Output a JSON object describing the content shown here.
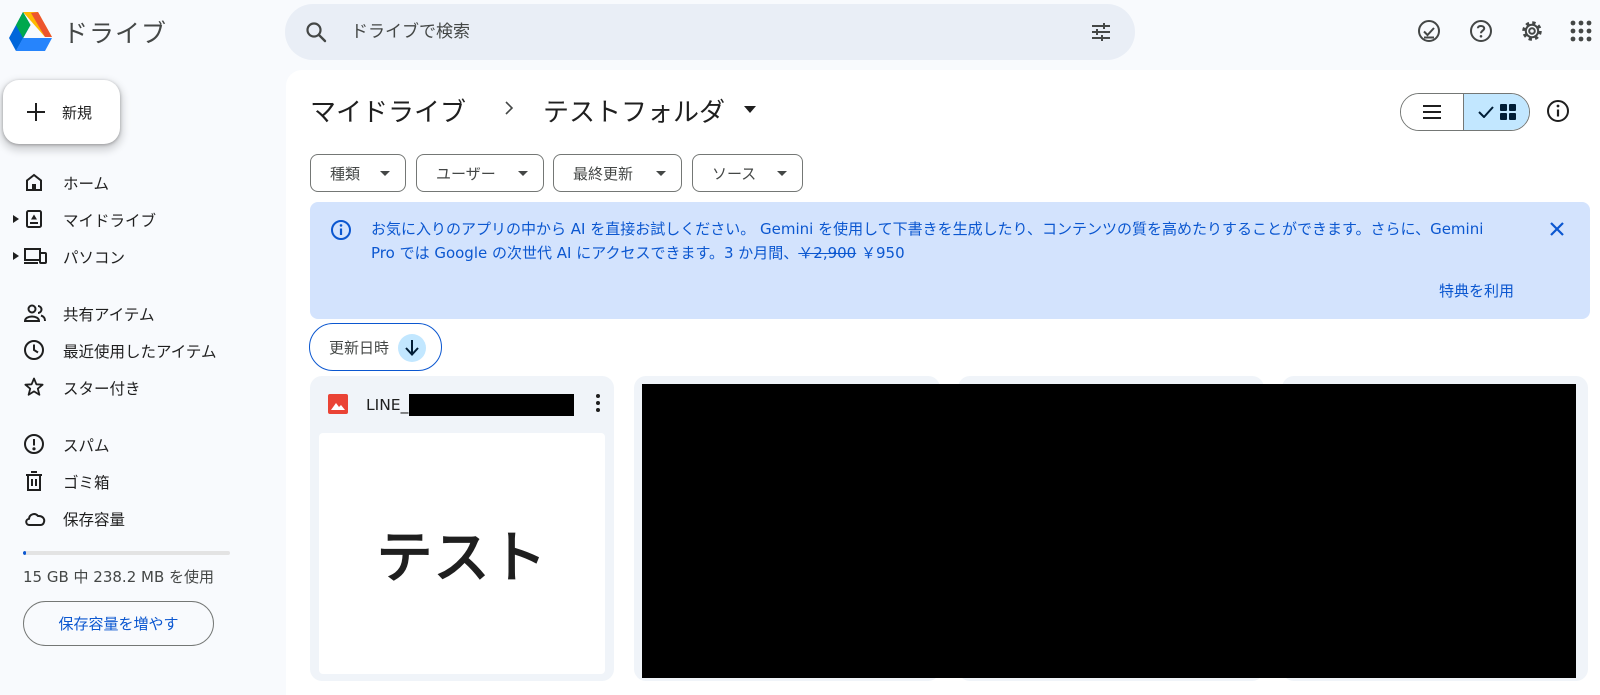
{
  "app": {
    "title": "ドライブ"
  },
  "search": {
    "placeholder": "ドライブで検索"
  },
  "header": {
    "icons": [
      "ready-for-offline-icon",
      "help-icon",
      "settings-icon",
      "apps-grid-icon"
    ]
  },
  "sidebar": {
    "new_label": "新規",
    "items": [
      {
        "label": "ホーム",
        "icon": "home-icon"
      },
      {
        "label": "マイドライブ",
        "icon": "my-drive-icon"
      },
      {
        "label": "パソコン",
        "icon": "computers-icon"
      },
      {
        "label": "共有アイテム",
        "icon": "shared-icon"
      },
      {
        "label": "最近使用したアイテム",
        "icon": "recent-icon"
      },
      {
        "label": "スター付き",
        "icon": "star-icon"
      },
      {
        "label": "スパム",
        "icon": "spam-icon"
      },
      {
        "label": "ゴミ箱",
        "icon": "trash-icon"
      },
      {
        "label": "保存容量",
        "icon": "cloud-icon"
      }
    ],
    "storage": {
      "used_fraction": 0.016,
      "text": "15 GB 中 238.2 MB を使用",
      "button": "保存容量を増やす"
    }
  },
  "breadcrumb": {
    "root": "マイドライブ",
    "separator": "›",
    "current": "テストフォルダ"
  },
  "filters": [
    "種類",
    "ユーザー",
    "最終更新",
    "ソース"
  ],
  "banner": {
    "text_before": "お気に入りのアプリの中から AI を直接お試しください。 Gemini を使用して下書きを生成したり、コンテンツの質を高めたりすることができます。さらに、Gemini Pro では Google の次世代 AI にアクセスできます。3 か月間、",
    "old_price": "￥2,900",
    "new_price": " ￥950",
    "action": "特典を利用"
  },
  "sort": {
    "label": "更新日時",
    "direction": "descending"
  },
  "files": [
    {
      "name_prefix": "LINE_",
      "type_icon": "image-file-icon",
      "thumbnail_text": "テスト"
    }
  ],
  "colors": {
    "accent": "#0b57d0",
    "banner_bg": "#d3e3fd",
    "selected_toggle": "#c2e7ff",
    "image_icon": "#ea4335"
  }
}
